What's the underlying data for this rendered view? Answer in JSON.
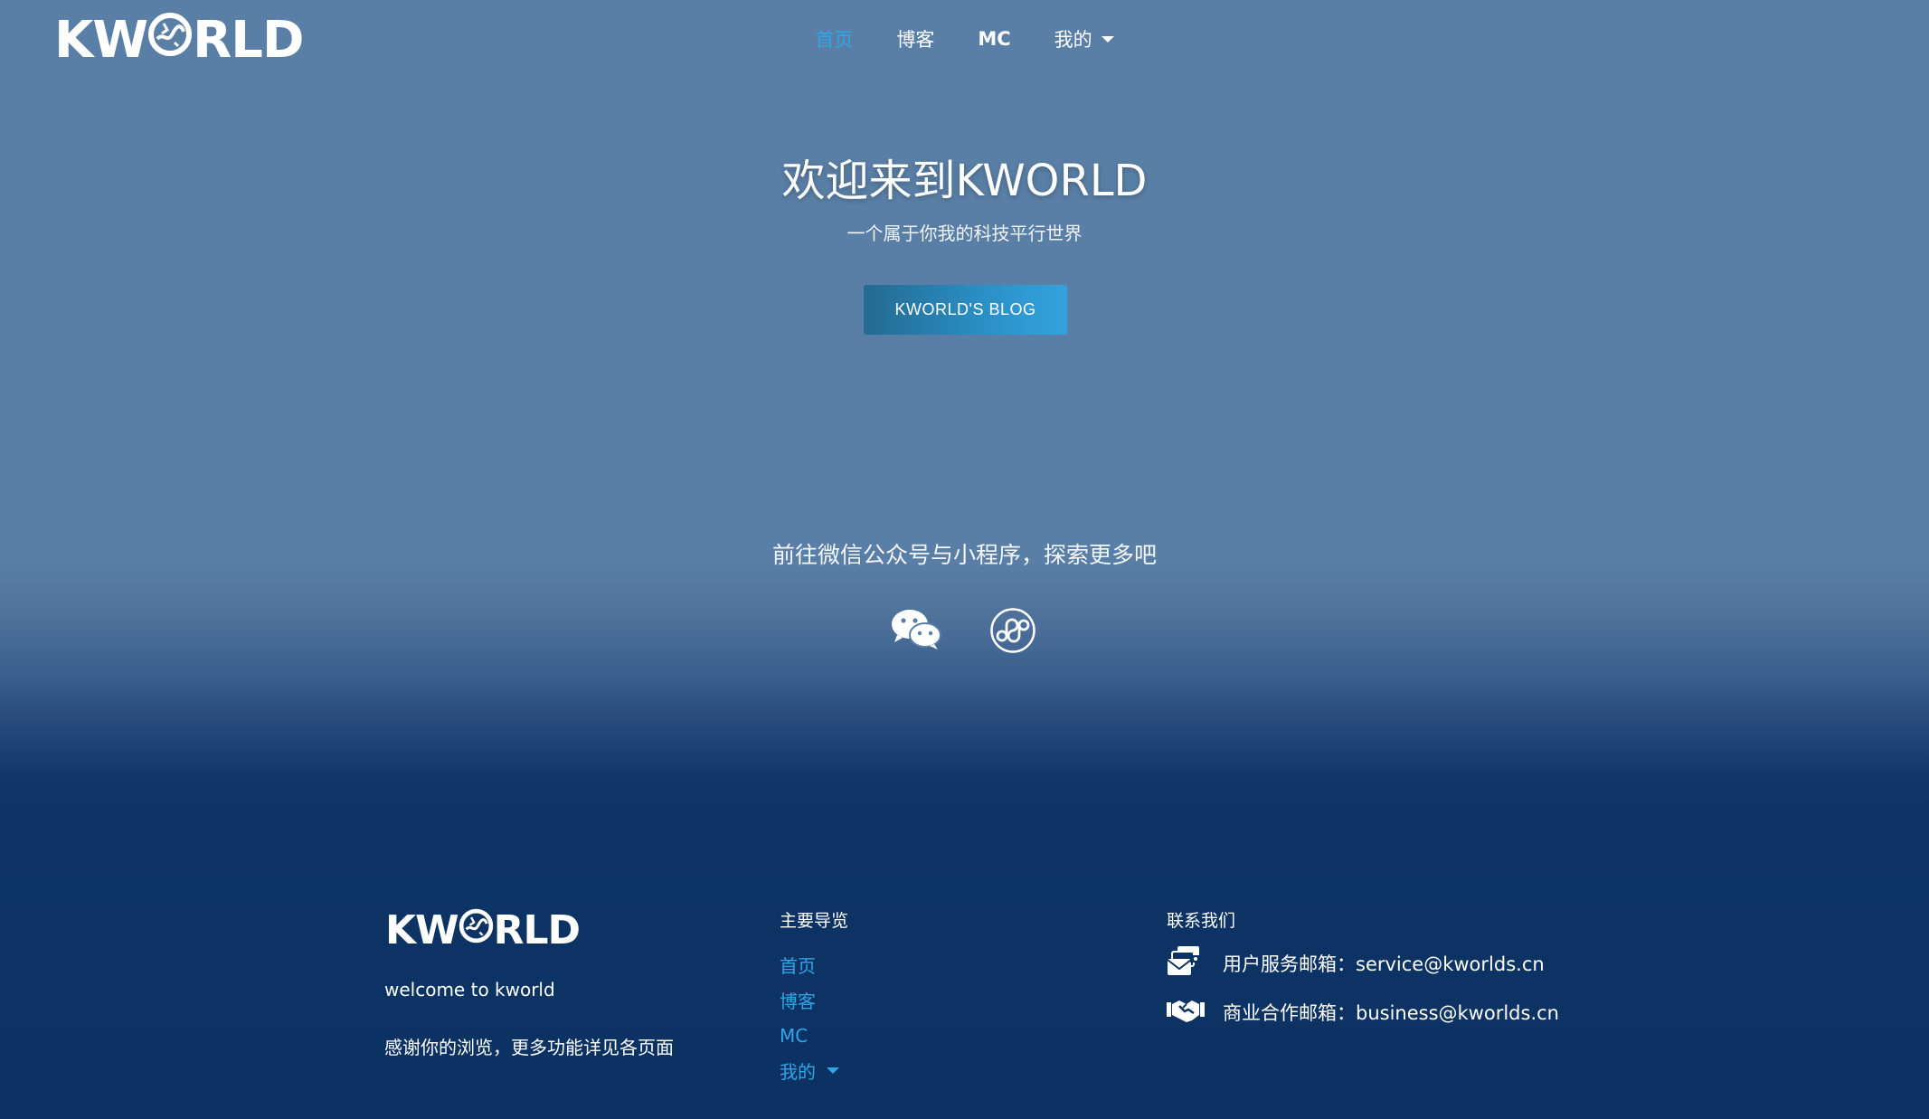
{
  "header": {
    "logo_left": "KW",
    "logo_right": "RLD",
    "nav": [
      {
        "label": "首页",
        "active": true
      },
      {
        "label": "博客"
      },
      {
        "label": "MC"
      },
      {
        "label": "我的",
        "dropdown": true
      }
    ]
  },
  "hero": {
    "title": "欢迎来到KWORLD",
    "subtitle": "一个属于你我的科技平行世界",
    "button_label": "KWORLD'S BLOG"
  },
  "social": {
    "title": "前往微信公众号与小程序，探索更多吧",
    "icons": [
      "wechat-icon",
      "mini-program-icon"
    ]
  },
  "footer": {
    "logo_left": "KW",
    "logo_right": "RLD",
    "welcome": "welcome to kworld",
    "thanks": "感谢你的浏览，更多功能详见各页面",
    "nav_heading": "主要导览",
    "nav": [
      {
        "label": "首页"
      },
      {
        "label": "博客"
      },
      {
        "label": "MC"
      },
      {
        "label": "我的",
        "dropdown": true
      }
    ],
    "contact_heading": "联系我们",
    "contacts": [
      {
        "icon": "mail-stack-icon",
        "text": "用户服务邮箱：service@kworlds.cn"
      },
      {
        "icon": "handshake-icon",
        "text": "商业合作邮箱：business@kworlds.cn"
      }
    ]
  },
  "colors": {
    "accent": "#2fa6e6",
    "bg_top": "#5a7fa6",
    "bg_bottom": "#0b3262"
  }
}
